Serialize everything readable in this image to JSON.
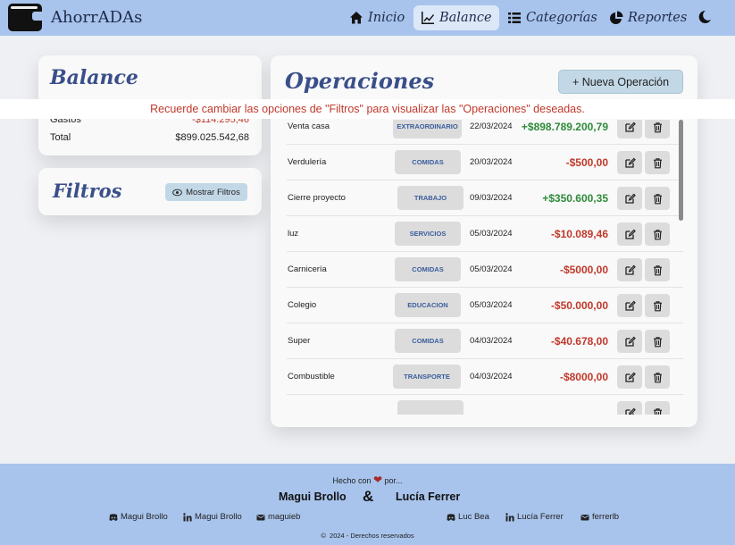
{
  "nav": {
    "brand": "AhorrADAs",
    "items": [
      {
        "label": "Inicio",
        "icon": "house-icon"
      },
      {
        "label": "Balance",
        "icon": "chart-line-icon"
      },
      {
        "label": "Categorías",
        "icon": "list-icon"
      },
      {
        "label": "Reportes",
        "icon": "pie-chart-icon"
      }
    ],
    "active": "Balance"
  },
  "balance": {
    "title": "Balance",
    "rows": [
      {
        "label": "Gastos",
        "value": "-$114.295,46"
      },
      {
        "label": "Total",
        "value": "$899.025.542,68"
      }
    ]
  },
  "filtros": {
    "title": "Filtros",
    "button_label": "Mostrar Filtros"
  },
  "alert": "Recuerde cambiar las opciones de \"Filtros\" para visualizar las \"Operaciones\" deseadas.",
  "operaciones": {
    "title": "Operaciones",
    "new_button_label": "+ Nueva Operación",
    "rows": [
      {
        "desc": "Venta casa",
        "cat": "EXTRAORDINARIO",
        "date": "22/03/2024",
        "amount": "+$898.789.200,79",
        "type": "pos"
      },
      {
        "desc": "Verdulería",
        "cat": "COMIDAS",
        "date": "20/03/2024",
        "amount": "-$500,00",
        "type": "neg"
      },
      {
        "desc": "Cierre proyecto",
        "cat": "TRABAJO",
        "date": "09/03/2024",
        "amount": "+$350.600,35",
        "type": "pos"
      },
      {
        "desc": "luz",
        "cat": "SERVICIOS",
        "date": "05/03/2024",
        "amount": "-$10.089,46",
        "type": "neg"
      },
      {
        "desc": "Carnicería",
        "cat": "COMIDAS",
        "date": "05/03/2024",
        "amount": "-$5000,00",
        "type": "neg"
      },
      {
        "desc": "Colegio",
        "cat": "EDUCACION",
        "date": "05/03/2024",
        "amount": "-$50.000,00",
        "type": "neg"
      },
      {
        "desc": "Super",
        "cat": "COMIDAS",
        "date": "04/03/2024",
        "amount": "-$40.678,00",
        "type": "neg"
      },
      {
        "desc": "Combustible",
        "cat": "TRANSPORTE",
        "date": "04/03/2024",
        "amount": "-$8000,00",
        "type": "neg"
      },
      {
        "desc": "",
        "cat": "",
        "date": "",
        "amount": "",
        "type": "neg"
      }
    ]
  },
  "footer": {
    "made_with": "Hecho con",
    "by": "por...",
    "author1": "Magui Brollo",
    "amp": "&",
    "author2": "Lucía Ferrer",
    "links1": [
      {
        "icon": "discord-icon",
        "label": "Magui Brollo"
      },
      {
        "icon": "linkedin-icon",
        "label": "Magui Brollo"
      },
      {
        "icon": "mail-icon",
        "label": "maguieb"
      }
    ],
    "links2": [
      {
        "icon": "discord-icon",
        "label": "Luc Bea"
      },
      {
        "icon": "linkedin-icon",
        "label": "Lucía Ferrer"
      },
      {
        "icon": "mail-icon",
        "label": "ferrerlb"
      }
    ],
    "copyright": "2024 - Derechos reservados"
  },
  "colors": {
    "nav_bg": "#a8c4ec",
    "accent": "#3a4f8a",
    "positive": "#2e8b3a",
    "negative": "#c0392b"
  }
}
